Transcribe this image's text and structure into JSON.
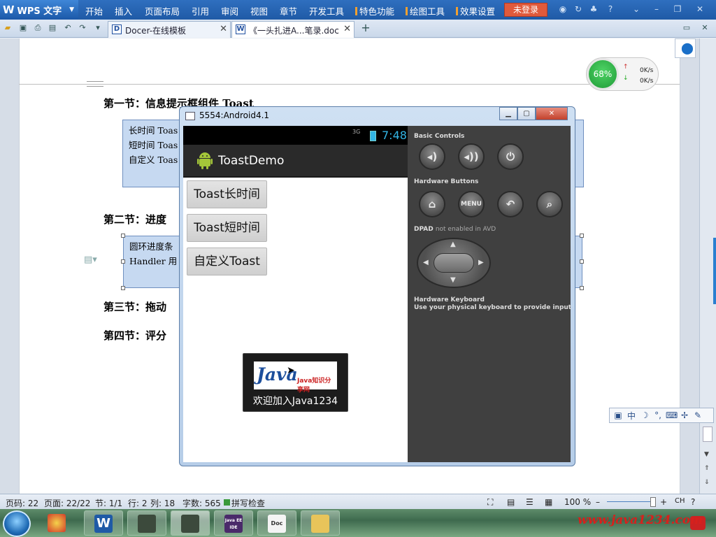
{
  "app": {
    "name": "WPS 文字",
    "menu": [
      "开始",
      "插入",
      "页面布局",
      "引用",
      "审阅",
      "视图",
      "章节",
      "开发工具",
      "特色功能",
      "绘图工具",
      "效果设置"
    ],
    "login": "未登录",
    "tabs": [
      {
        "label": "Docer-在线模板",
        "icon": "D"
      },
      {
        "label": "《一头扎进A...笔录.doc",
        "icon": "W"
      }
    ]
  },
  "document": {
    "headings": [
      "第一节：信息提示框组件 Toast",
      "第二节：进度",
      "第三节：拖动",
      "第四节：评分"
    ],
    "box1": [
      "长时间 Toas",
      "短时间 Toas",
      "自定义 Toas"
    ],
    "box2": [
      "圆环进度条",
      "Handler  用"
    ]
  },
  "network": {
    "percent": "68%",
    "up": "0K/s",
    "down": "0K/s"
  },
  "emulator": {
    "title": "5554:Android4.1",
    "time": "7:48",
    "network_type": "3G",
    "app_title": "ToastDemo",
    "buttons": [
      "Toast长时间",
      "Toast短时间",
      "自定义Toast"
    ],
    "toast": {
      "logo_text": "Java知识分享网",
      "message": "欢迎加入Java1234"
    },
    "panel": {
      "basic_controls": "Basic Controls",
      "hardware_buttons": "Hardware Buttons",
      "menu_label": "MENU",
      "dpad_prefix": "DPAD",
      "dpad_note": "not enabled in AVD",
      "keyboard_title": "Hardware Keyboard",
      "keyboard_note": "Use your physical keyboard to provide input"
    }
  },
  "status": {
    "page_code": "页码: 22",
    "page": "页面: 22/22",
    "section": "节: 1/1",
    "line": "行: 2",
    "column": "列: 18",
    "words": "字数: 565",
    "spell": "拼写检查",
    "zoom": "100 %"
  },
  "ime": {
    "mode": "中",
    "label": "CH"
  },
  "watermark": "www.java1234.com",
  "taskbar": {
    "items": [
      "W",
      "Android",
      "Android",
      "Java EE IDE",
      "Doc",
      "Folder"
    ]
  }
}
